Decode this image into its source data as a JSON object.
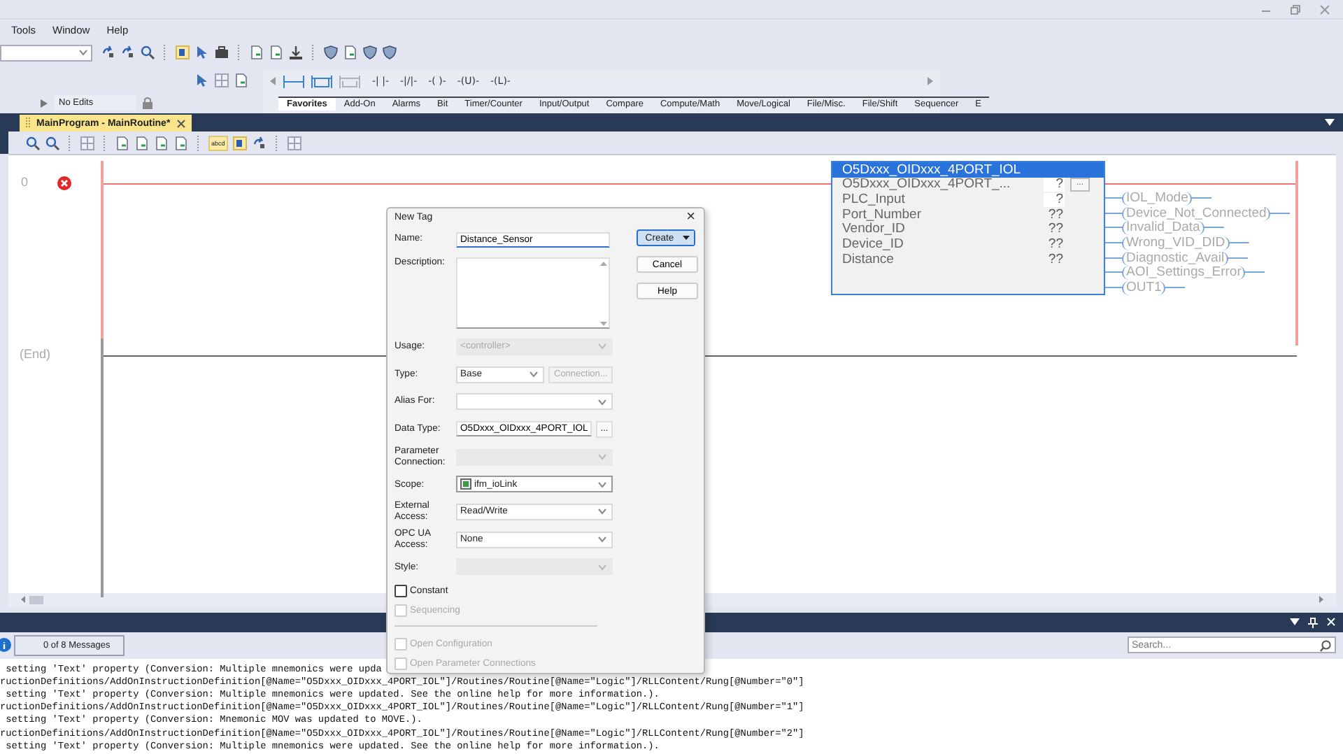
{
  "menu": [
    {
      "label": "Tools"
    },
    {
      "label": "Window"
    },
    {
      "label": "Help"
    }
  ],
  "edit_status": "No Edits",
  "ladder_elements": [
    "-| |-",
    "-|/|-",
    "-( )-",
    "-(U)-",
    "-(L)-"
  ],
  "instruction_tabs": [
    {
      "label": "Favorites",
      "selected": true
    },
    {
      "label": "Add-On",
      "selected": false
    },
    {
      "label": "Alarms",
      "selected": false
    },
    {
      "label": "Bit",
      "selected": false
    },
    {
      "label": "Timer/Counter",
      "selected": false
    },
    {
      "label": "Input/Output",
      "selected": false
    },
    {
      "label": "Compare",
      "selected": false
    },
    {
      "label": "Compute/Math",
      "selected": false
    },
    {
      "label": "Move/Logical",
      "selected": false
    },
    {
      "label": "File/Misc.",
      "selected": false
    },
    {
      "label": "File/Shift",
      "selected": false
    },
    {
      "label": "Sequencer",
      "selected": false
    },
    {
      "label": "E",
      "selected": false
    }
  ],
  "routine_tab": {
    "label": "MainProgram - MainRoutine*",
    "selected": true
  },
  "routine_toolbar": {
    "toggle_label": "abcd"
  },
  "ladder": {
    "rungs": [
      {
        "number": "0",
        "error": true
      }
    ],
    "end_label": "(End)",
    "instruction": {
      "title": "O5Dxxx_OIDxxx_4PORT_IOL",
      "parameters": [
        {
          "name": "O5Dxxx_OIDxxx_4PORT_...",
          "value": "?",
          "kind": "tag-browse",
          "browse_label": "..."
        },
        {
          "name": "PLC_Input",
          "value": "?",
          "kind": "tag"
        },
        {
          "name": "Port_Number",
          "value": "??",
          "kind": "readout"
        },
        {
          "name": "Vendor_ID",
          "value": "??",
          "kind": "readout"
        },
        {
          "name": "Device_ID",
          "value": "??",
          "kind": "readout"
        },
        {
          "name": "Distance",
          "value": "??",
          "kind": "readout"
        }
      ],
      "outputs": [
        "IOL_Mode",
        "Device_Not_Connected",
        "Invalid_Data",
        "Wrong_VID_DID",
        "Diagnostic_Avail",
        "AOI_Settings_Error",
        "OUT1"
      ]
    }
  },
  "output_window": {
    "message_filter": "0 of 8 Messages",
    "search_placeholder": "Search...",
    "lines": [
      " setting 'Text' property (Conversion: Multiple mnemonics were upda",
      "ructionDefinitions/AddOnInstructionDefinition[@Name=\"O5Dxxx_OIDxxx_4PORT_IOL\"]/Routines/Routine[@Name=\"Logic\"]/RLLContent/Rung[@Number=\"0\"]",
      " setting 'Text' property (Conversion: Multiple mnemonics were updated. See the online help for more information.).",
      "ructionDefinitions/AddOnInstructionDefinition[@Name=\"O5Dxxx_OIDxxx_4PORT_IOL\"]/Routines/Routine[@Name=\"Logic\"]/RLLContent/Rung[@Number=\"1\"]",
      " setting 'Text' property (Conversion: Mnemonic MOV was updated to MOVE.).",
      "ructionDefinitions/AddOnInstructionDefinition[@Name=\"O5Dxxx_OIDxxx_4PORT_IOL\"]/Routines/Routine[@Name=\"Logic\"]/RLLContent/Rung[@Number=\"2\"]",
      " setting 'Text' property (Conversion: Multiple mnemonics were updated. See the online help for more information.)."
    ]
  },
  "dialog": {
    "title": "New Tag",
    "close": "×",
    "fields": [
      {
        "label": "Name:",
        "kind": "text",
        "value": "Distance_Sensor",
        "disabled": false,
        "focused": true
      },
      {
        "label": "Description:",
        "kind": "textarea",
        "disabled": false
      },
      {
        "label": "Usage:",
        "kind": "combo",
        "value": "<controller>",
        "disabled": true
      },
      {
        "label": "Type:",
        "kind": "combo-button",
        "value": "Base",
        "disabled": false,
        "button": {
          "label": "Connection...",
          "disabled": true
        }
      },
      {
        "label": "Alias For:",
        "kind": "combo",
        "disabled": false
      },
      {
        "label": "Data Type:",
        "kind": "text-button",
        "value": "O5Dxxx_OIDxxx_4PORT_IOL",
        "disabled": false,
        "button": {
          "label": "...",
          "disabled": false
        }
      },
      {
        "label": "Parameter Connection:",
        "kind": "combo",
        "disabled": true
      },
      {
        "label": "Scope:",
        "kind": "combo-icon",
        "value": "ifm_ioLink",
        "disabled": false
      },
      {
        "label": "External Access:",
        "kind": "combo",
        "value": "Read/Write",
        "disabled": false
      },
      {
        "label": "OPC UA Access:",
        "kind": "combo",
        "value": "None",
        "disabled": false
      },
      {
        "label": "Style:",
        "kind": "combo",
        "disabled": true
      }
    ],
    "buttons": [
      {
        "label": "Create",
        "kind": "split",
        "default": true
      },
      {
        "label": "Cancel",
        "kind": "plain",
        "default": false
      },
      {
        "label": "Help",
        "kind": "plain",
        "default": false
      }
    ],
    "options": [
      {
        "label": "Constant",
        "checked": false,
        "disabled": false
      },
      {
        "label": "Sequencing",
        "checked": false,
        "disabled": true
      }
    ],
    "more_options": [
      {
        "label": "Open Configuration",
        "checked": false,
        "disabled": true
      },
      {
        "label": "Open Parameter Connections",
        "checked": false,
        "disabled": true
      }
    ]
  }
}
